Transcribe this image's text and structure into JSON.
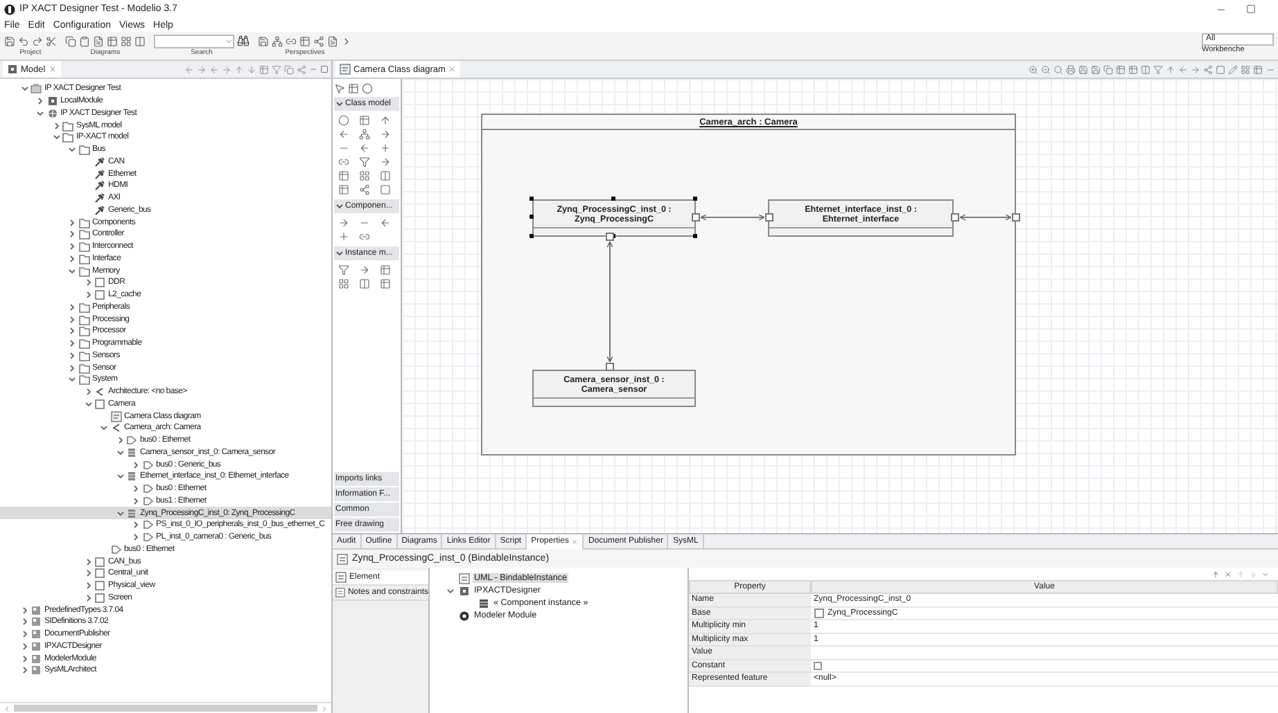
{
  "window": {
    "title": "IP XACT Designer Test - Modelio 3.7"
  },
  "menu": [
    "File",
    "Edit",
    "Configuration",
    "Views",
    "Help"
  ],
  "toolbar": {
    "groups": [
      "Project",
      "Diagrams",
      "Search",
      "Perspectives"
    ],
    "perspective_field": {
      "value": "All"
    },
    "workbench_label": "Workbenche"
  },
  "model_panel": {
    "tab": "Model",
    "tree": [
      {
        "label": "IP XACT Designer Test",
        "kind": "project",
        "expanded": true,
        "selected": false,
        "children": [
          {
            "label": "LocalModule",
            "kind": "module",
            "expanded": false,
            "selected": false
          },
          {
            "label": "IP XACT Designer Test",
            "kind": "model",
            "expanded": true,
            "selected": false,
            "children": [
              {
                "label": "SysML model",
                "kind": "folder",
                "expanded": false,
                "selected": false
              },
              {
                "label": "IP-XACT model",
                "kind": "folder",
                "expanded": true,
                "selected": false,
                "children": [
                  {
                    "label": "Bus",
                    "kind": "folder",
                    "expanded": true,
                    "selected": false,
                    "children": [
                      {
                        "label": "CAN",
                        "kind": "bus",
                        "selected": false
                      },
                      {
                        "label": "Ethernet",
                        "kind": "bus",
                        "selected": false
                      },
                      {
                        "label": "HDMI",
                        "kind": "bus",
                        "selected": false
                      },
                      {
                        "label": "AXI",
                        "kind": "bus",
                        "selected": false
                      },
                      {
                        "label": "Generic_bus",
                        "kind": "bus",
                        "selected": false
                      }
                    ]
                  },
                  {
                    "label": "Components",
                    "kind": "folder",
                    "expanded": false,
                    "selected": false
                  },
                  {
                    "label": "Controller",
                    "kind": "folder",
                    "expanded": false,
                    "selected": false
                  },
                  {
                    "label": "Interconnect",
                    "kind": "folder",
                    "expanded": false,
                    "selected": false
                  },
                  {
                    "label": "Interface",
                    "kind": "folder",
                    "expanded": false,
                    "selected": false
                  },
                  {
                    "label": "Memory",
                    "kind": "folder",
                    "expanded": true,
                    "selected": false,
                    "children": [
                      {
                        "label": "DDR",
                        "kind": "class",
                        "expanded": false,
                        "selected": false
                      },
                      {
                        "label": "L2_cache",
                        "kind": "class",
                        "expanded": false,
                        "selected": false
                      }
                    ]
                  },
                  {
                    "label": "Peripherals",
                    "kind": "folder",
                    "expanded": false,
                    "selected": false
                  },
                  {
                    "label": "Processing",
                    "kind": "folder",
                    "expanded": false,
                    "selected": false
                  },
                  {
                    "label": "Processor",
                    "kind": "folder",
                    "expanded": false,
                    "selected": false
                  },
                  {
                    "label": "Programmable",
                    "kind": "folder",
                    "expanded": false,
                    "selected": false
                  },
                  {
                    "label": "Sensors",
                    "kind": "folder",
                    "expanded": false,
                    "selected": false
                  },
                  {
                    "label": "Sensor",
                    "kind": "folder",
                    "expanded": false,
                    "selected": false
                  },
                  {
                    "label": "System",
                    "kind": "folder",
                    "expanded": true,
                    "selected": false,
                    "children": [
                      {
                        "label": "Architecture: <no base>",
                        "kind": "architecture",
                        "expanded": false,
                        "selected": false
                      },
                      {
                        "label": "Camera",
                        "kind": "class",
                        "expanded": true,
                        "selected": false,
                        "children": [
                          {
                            "label": "Camera Class diagram",
                            "kind": "diagram",
                            "selected": false
                          },
                          {
                            "label": "Camera_arch: Camera",
                            "kind": "architecture",
                            "expanded": true,
                            "selected": false,
                            "children": [
                              {
                                "label": "bus0 : Ethernet",
                                "kind": "port",
                                "expanded": false,
                                "selected": false
                              },
                              {
                                "label": "Camera_sensor_inst_0: Camera_sensor",
                                "kind": "instance",
                                "expanded": true,
                                "selected": false,
                                "children": [
                                  {
                                    "label": "bus0 : Generic_bus",
                                    "kind": "port",
                                    "expanded": false,
                                    "selected": false
                                  }
                                ]
                              },
                              {
                                "label": "Ethernet_interface_inst_0: Ethernet_interface",
                                "kind": "instance",
                                "expanded": true,
                                "selected": false,
                                "children": [
                                  {
                                    "label": "bus0 : Ethernet",
                                    "kind": "port",
                                    "expanded": false,
                                    "selected": false
                                  },
                                  {
                                    "label": "bus1 : Ethernet",
                                    "kind": "port",
                                    "expanded": false,
                                    "selected": false
                                  }
                                ]
                              },
                              {
                                "label": "Zynq_ProcessingC_inst_0: Zynq_ProcessingC",
                                "kind": "instance",
                                "expanded": true,
                                "selected": true,
                                "children": [
                                  {
                                    "label": "PS_inst_0_IO_peripherals_inst_0_bus_ethernet_C",
                                    "kind": "port",
                                    "expanded": false,
                                    "selected": false
                                  },
                                  {
                                    "label": "PL_inst_0_camera0 : Generic_bus",
                                    "kind": "port",
                                    "expanded": false,
                                    "selected": false
                                  }
                                ]
                              }
                            ]
                          },
                          {
                            "label": "bus0 : Ethernet",
                            "kind": "port",
                            "selected": false
                          }
                        ]
                      },
                      {
                        "label": "CAN_bus",
                        "kind": "class",
                        "expanded": false,
                        "selected": false
                      },
                      {
                        "label": "Central_unit",
                        "kind": "class",
                        "expanded": false,
                        "selected": false
                      },
                      {
                        "label": "Physical_view",
                        "kind": "class",
                        "expanded": false,
                        "selected": false
                      },
                      {
                        "label": "Screen",
                        "kind": "class",
                        "expanded": false,
                        "selected": false
                      }
                    ]
                  }
                ]
              }
            ]
          }
        ]
      },
      {
        "label": "PredefinedTypes 3.7.04",
        "kind": "library",
        "expanded": false,
        "selected": false
      },
      {
        "label": "SIDefinitions 3.7.02",
        "kind": "library",
        "expanded": false,
        "selected": false
      },
      {
        "label": "DocumentPublisher",
        "kind": "library",
        "expanded": false,
        "selected": false
      },
      {
        "label": "IPXACTDesigner",
        "kind": "library",
        "expanded": false,
        "selected": false
      },
      {
        "label": "ModelerModule",
        "kind": "library",
        "expanded": false,
        "selected": false
      },
      {
        "label": "SysMLArchitect",
        "kind": "library",
        "expanded": false,
        "selected": false
      }
    ]
  },
  "diagram": {
    "tab": "Camera Class diagram",
    "palette": {
      "sections": [
        {
          "label": "Class model",
          "expanded": true
        },
        {
          "label": "Componen...",
          "expanded": true
        },
        {
          "label": "Instance m...",
          "expanded": true
        }
      ],
      "bottom_sections": [
        "Imports links",
        "Information F...",
        "Common",
        "Free drawing"
      ]
    },
    "frame": {
      "title": "Camera_arch : Camera"
    },
    "nodes": [
      {
        "name": "Zynq_ProcessingC_inst_0 :",
        "type": "Zynq_ProcessingC",
        "selected": true
      },
      {
        "name": "Ehternet_interface_inst_0 :",
        "type": "Ehternet_interface",
        "selected": false
      },
      {
        "name": "Camera_sensor_inst_0 :",
        "type": "Camera_sensor",
        "selected": false
      }
    ]
  },
  "bottom": {
    "tabs": [
      {
        "label": "Audit",
        "selected": false
      },
      {
        "label": "Outline",
        "selected": false
      },
      {
        "label": "Diagrams",
        "selected": false
      },
      {
        "label": "Links Editor",
        "selected": false
      },
      {
        "label": "Script",
        "selected": false
      },
      {
        "label": "Properties",
        "selected": true
      },
      {
        "label": "Document Publisher",
        "selected": false
      },
      {
        "label": "SysML",
        "selected": false
      }
    ],
    "title": "Zynq_ProcessingC_inst_0 (BindableInstance)",
    "side_tabs": [
      {
        "label": "Element",
        "selected": true
      },
      {
        "label": "Notes and constraints",
        "selected": false
      }
    ],
    "element_tree": [
      {
        "label": "UML - BindableInstance",
        "kind": "uml",
        "selected": true
      },
      {
        "label": "IPXACTDesigner",
        "kind": "module",
        "expanded": true,
        "selected": false,
        "children": [
          {
            "label": "« Component instance »",
            "kind": "stereotype",
            "selected": false
          }
        ]
      },
      {
        "label": "Modeler Module",
        "kind": "modeler",
        "selected": false
      }
    ],
    "properties": {
      "columns": [
        "Property",
        "Value"
      ],
      "rows": [
        {
          "property": "Name",
          "kind": "text",
          "value": "Zynq_ProcessingC_inst_0"
        },
        {
          "property": "Base",
          "kind": "link",
          "value": "Zynq_ProcessingC"
        },
        {
          "property": "Multiplicity min",
          "kind": "text",
          "value": "1"
        },
        {
          "property": "Multiplicity max",
          "kind": "text",
          "value": "1"
        },
        {
          "property": "Value",
          "kind": "empty"
        },
        {
          "property": "Constant",
          "kind": "checkbox",
          "checked": false
        },
        {
          "property": "Represented feature",
          "kind": "text",
          "value": "<null>"
        }
      ]
    }
  }
}
